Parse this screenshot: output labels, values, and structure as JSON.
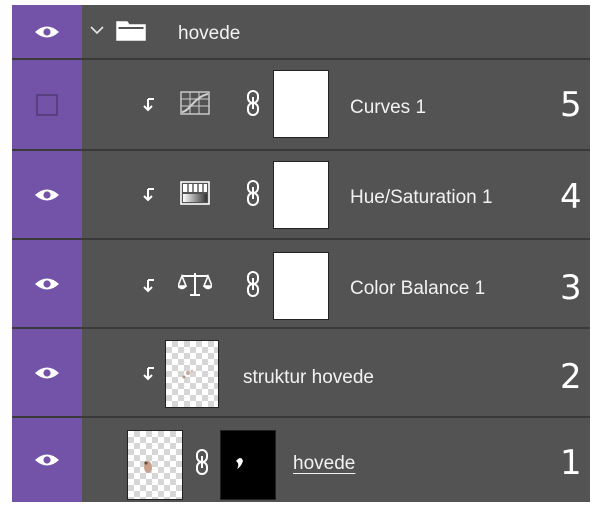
{
  "group": {
    "name": "hovede",
    "icons": {
      "expand": "chevron-down-icon",
      "folder": "folder-icon"
    }
  },
  "layers": [
    {
      "name": "Curves 1",
      "number": "5",
      "visible": false,
      "type": "curves-adjustment",
      "clipped": true
    },
    {
      "name": "Hue/Saturation 1",
      "number": "4",
      "visible": true,
      "type": "hue-saturation-adjustment",
      "clipped": true
    },
    {
      "name": "Color Balance 1",
      "number": "3",
      "visible": true,
      "type": "color-balance-adjustment",
      "clipped": true
    },
    {
      "name": "struktur hovede",
      "number": "2",
      "visible": true,
      "type": "pixel-layer",
      "clipped": true
    },
    {
      "name": "hovede",
      "number": "1",
      "visible": true,
      "type": "pixel-layer-with-mask",
      "clipped": false
    }
  ],
  "colors": {
    "panel": "#535353",
    "visibility_column": "#7353a8",
    "text": "#f2f2f2"
  }
}
